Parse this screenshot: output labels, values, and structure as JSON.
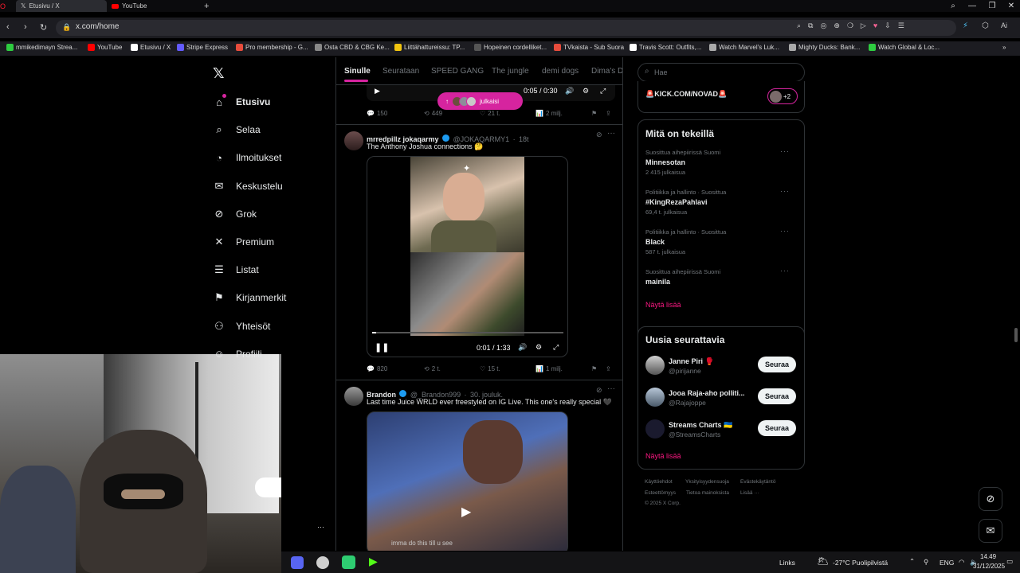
{
  "browser": {
    "tabs": [
      {
        "label": "Etusivu / X",
        "active": true
      },
      {
        "label": "YouTube",
        "active": false
      }
    ],
    "url": "x.com/home",
    "bookmarks": [
      {
        "label": "mmikedimayn Strea...",
        "color": "#2ecc40"
      },
      {
        "label": "YouTube",
        "color": "#ff0000"
      },
      {
        "label": "Etusivu / X",
        "color": "#ffffff"
      },
      {
        "label": "Stripe Express",
        "color": "#635bff"
      },
      {
        "label": "Pro membership - G...",
        "color": "#e74c3c"
      },
      {
        "label": "Osta CBD & CBG Ke...",
        "color": "#888888"
      },
      {
        "label": "Liittähattureissu: TP...",
        "color": "#f1c40f"
      },
      {
        "label": "Hopeinen cordelliket...",
        "color": "#555555"
      },
      {
        "label": "TVkaista - Sub Suora",
        "color": "#e74c3c"
      },
      {
        "label": "Travis Scott: Outfits,...",
        "color": "#ffffff"
      },
      {
        "label": "Watch Marvel's Luk...",
        "color": "#aaaaaa"
      },
      {
        "label": "Mighty Ducks: Bank...",
        "color": "#aaaaaa"
      },
      {
        "label": "Watch Global & Loc...",
        "color": "#2ecc40"
      }
    ]
  },
  "nav": {
    "items": [
      {
        "label": "Etusivu",
        "icon": "home-icon",
        "glyph": "⌂"
      },
      {
        "label": "Selaa",
        "icon": "search-icon",
        "glyph": "⌕"
      },
      {
        "label": "Ilmoitukset",
        "icon": "bell-icon",
        "glyph": "◔"
      },
      {
        "label": "Keskustelu",
        "icon": "mail-icon",
        "glyph": "✉"
      },
      {
        "label": "Grok",
        "icon": "grok-icon",
        "glyph": "⊘"
      },
      {
        "label": "Premium",
        "icon": "x-icon",
        "glyph": "✕"
      },
      {
        "label": "Listat",
        "icon": "list-icon",
        "glyph": "☰"
      },
      {
        "label": "Kirjanmerkit",
        "icon": "bookmark-icon",
        "glyph": "⚑"
      },
      {
        "label": "Yhteisöt",
        "icon": "communities-icon",
        "glyph": "⚇"
      },
      {
        "label": "Profiili",
        "icon": "profile-icon",
        "glyph": "☺"
      }
    ]
  },
  "feed": {
    "tabs": [
      "Sinulle",
      "Seurataan",
      "SPEED GANG",
      "The jungle",
      "demi dogs",
      "Dima's Di"
    ],
    "top_video": {
      "time": "0:05 / 0:30",
      "pill": "julkaisi"
    },
    "top_actions": {
      "replies": "150",
      "reposts": "449",
      "likes": "21 t.",
      "views": "2 milj."
    },
    "tweets": [
      {
        "name": "mrredpillz jokaqarmy",
        "handle": "@JOKAQARMY1",
        "time": "18t",
        "text": "The Anthony Joshua connections 🤔",
        "video_time": "0:01 / 1:33",
        "actions": {
          "replies": "820",
          "reposts": "2 t.",
          "likes": "15 t.",
          "views": "1 milj."
        }
      },
      {
        "name": "Brandon",
        "handle": "@_Brandon999",
        "time": "30. jouluk.",
        "text": "Last time Juice WRLD ever freestyled on IG Live. This one's really special 🖤",
        "caption": "imma do this till u see"
      }
    ]
  },
  "sidebar": {
    "search_placeholder": "Hae",
    "kick_text": "🚨KICK.COM/NOVAD🚨",
    "kick_count": "+2",
    "trends_title": "Mitä on tekeillä",
    "trends": [
      {
        "meta": "Suosittua aihepiirissä Suomi",
        "name": "Minnesotan",
        "count": "2 415 julkaisua"
      },
      {
        "meta": "Politiikka ja hallinto · Suosittua",
        "name": "#KingRezaPahlavi",
        "count": "69,4 t. julkaisua"
      },
      {
        "meta": "Politiikka ja hallinto · Suosittua",
        "name": "Black",
        "count": "587 t. julkaisua"
      },
      {
        "meta": "Suosittua aihepiirissä Suomi",
        "name": "mainila",
        "count": ""
      }
    ],
    "show_more": "Näytä lisää",
    "follow_title": "Uusia seurattavia",
    "follow": [
      {
        "name": "Janne Piri 🥊",
        "handle": "@pirijanne",
        "button": "Seuraa"
      },
      {
        "name": "Jooa Raja-aho polliti...",
        "handle": "@Rajajoppe",
        "button": "Seuraa"
      },
      {
        "name": "Streams Charts 🇺🇦",
        "handle": "@StreamsCharts",
        "button": "Seuraa"
      }
    ],
    "footer": [
      "Käyttöehdot",
      "Yksityisyydensuoja",
      "Evästekäytäntö",
      "Esteettömyys",
      "Tietoa mainoksista",
      "Lisää ···",
      "© 2025 X Corp."
    ]
  },
  "taskbar": {
    "links": "Links",
    "weather": "-27°C  Puolipilvistä",
    "lang": "ENG",
    "time": "14.49",
    "date": "31/12/2025"
  }
}
